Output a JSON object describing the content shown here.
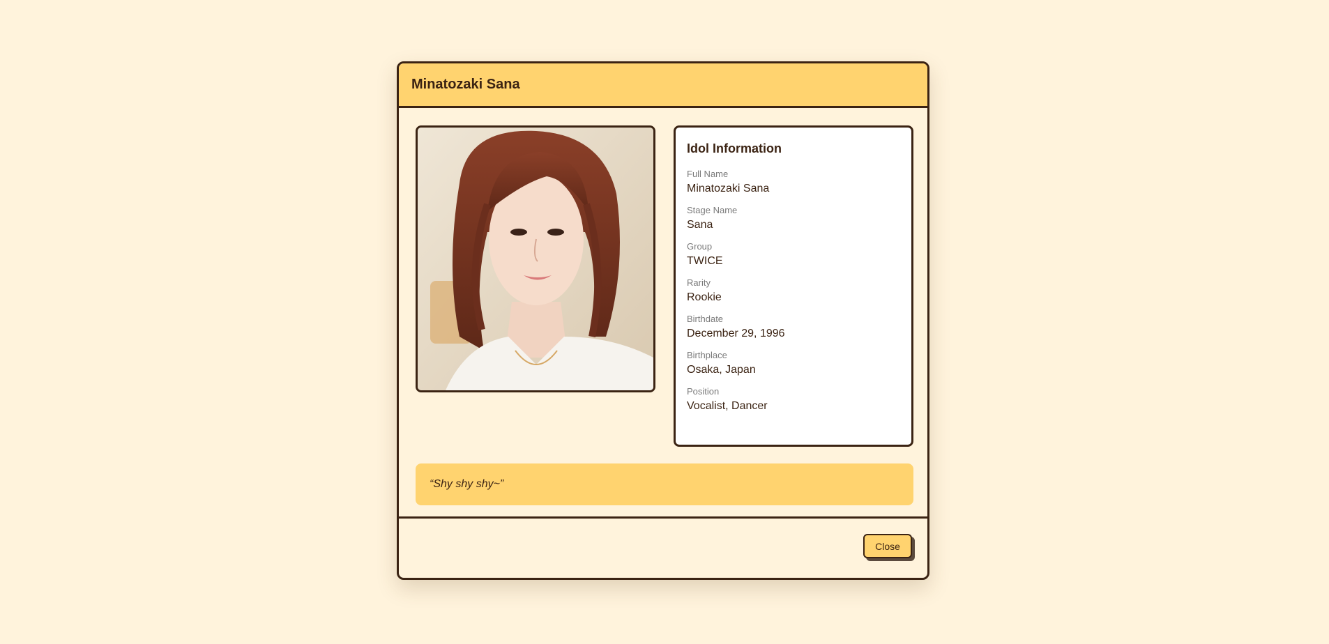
{
  "modal": {
    "title": "Minatozaki Sana",
    "photo_alt": "Portrait photo of Minatozaki Sana",
    "info": {
      "heading": "Idol Information",
      "fields": [
        {
          "label": "Full Name",
          "value": "Minatozaki Sana"
        },
        {
          "label": "Stage Name",
          "value": "Sana"
        },
        {
          "label": "Group",
          "value": "TWICE"
        },
        {
          "label": "Rarity",
          "value": "Rookie"
        },
        {
          "label": "Birthdate",
          "value": "December 29, 1996"
        },
        {
          "label": "Birthplace",
          "value": "Osaka, Japan"
        },
        {
          "label": "Position",
          "value": "Vocalist, Dancer"
        }
      ]
    },
    "quote": "“Shy shy shy~”",
    "close_label": "Close"
  },
  "colors": {
    "background": "#fff3dc",
    "accent": "#ffd36f",
    "border": "#3b2313",
    "card": "#ffffff",
    "label_gray": "#7a7a7a"
  }
}
